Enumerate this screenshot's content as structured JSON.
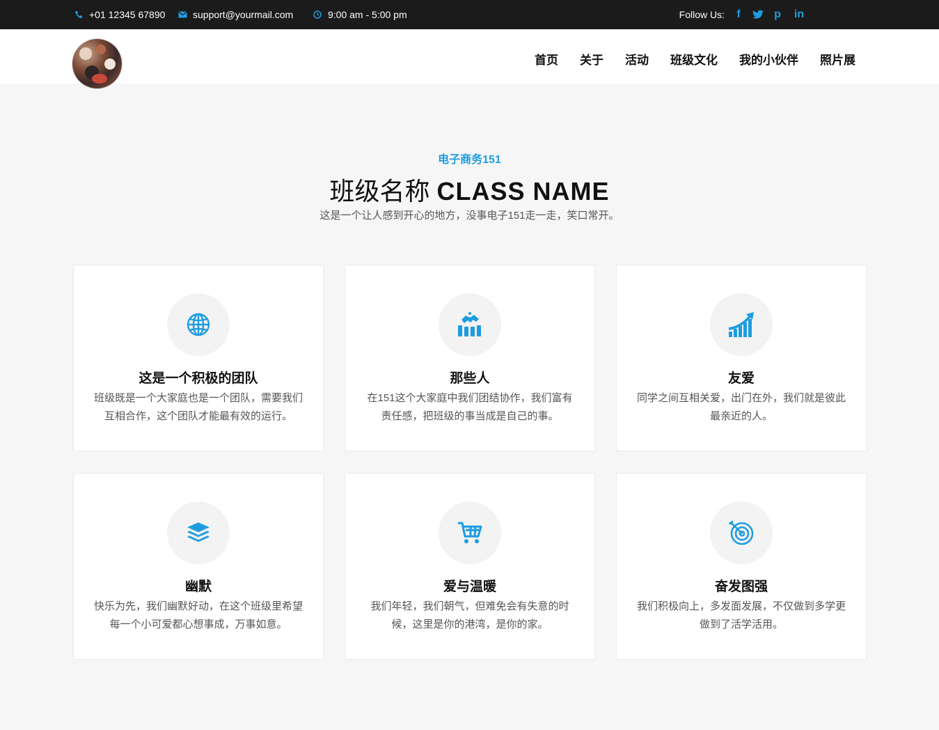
{
  "topbar": {
    "phone": "+01 12345 67890",
    "email": "support@yourmail.com",
    "hours": "9:00 am - 5:00 pm",
    "follow_label": "Follow Us:",
    "social": [
      "f",
      "t",
      "p",
      "in"
    ]
  },
  "nav": [
    "首页",
    "关于",
    "活动",
    "班级文化",
    "我的小伙伴",
    "照片展"
  ],
  "hero": {
    "subtitle": "电子商务151",
    "title_cn": "班级名称",
    "title_en": "CLASS NAME",
    "description": "这是一个让人感到开心的地方，没事电子151走一走，笑口常开。"
  },
  "cards": [
    {
      "icon": "globe-icon",
      "title": "这是一个积极的团队",
      "text": "班级既是一个大家庭也是一个团队，需要我们互相合作，这个团队才能最有效的运行。"
    },
    {
      "icon": "handshake-chart-icon",
      "title": "那些人",
      "text": "在151这个大家庭中我们团结协作，我们富有责任感，把班级的事当成是自己的事。"
    },
    {
      "icon": "growth-chart-icon",
      "title": "友爱",
      "text": "同学之间互相关爱，出门在外，我们就是彼此最亲近的人。"
    },
    {
      "icon": "layers-icon",
      "title": "幽默",
      "text": "快乐为先，我们幽默好动，在这个班级里希望每一个小可爱都心想事成，万事如意。"
    },
    {
      "icon": "cart-icon",
      "title": "爱与温暖",
      "text": "我们年轻，我们朝气，但难免会有失意的时候，这里是你的港湾，是你的家。"
    },
    {
      "icon": "target-icon",
      "title": "奋发图强",
      "text": "我们积极向上，多发面发展，不仅做到多学更做到了活学活用。"
    }
  ],
  "colors": {
    "accent": "#1e9ce0",
    "topbar_bg": "#1b1b1b",
    "page_bg": "#f6f6f6"
  }
}
